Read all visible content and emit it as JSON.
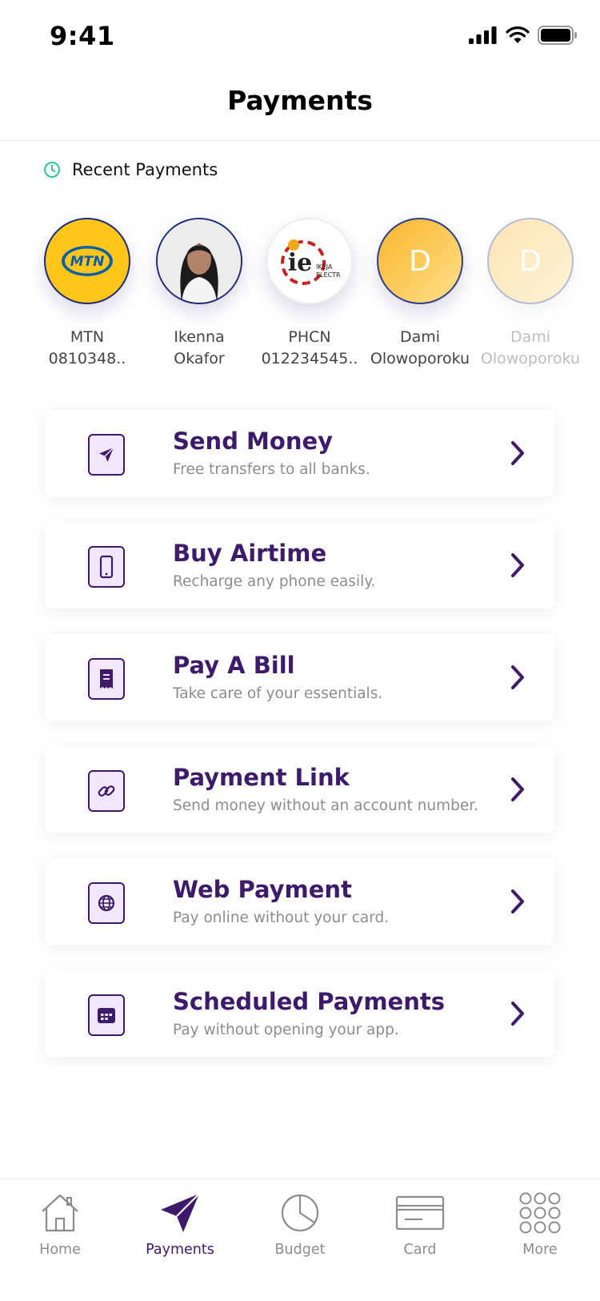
{
  "status_bar": {
    "time": "9:41"
  },
  "header": {
    "title": "Payments"
  },
  "recent": {
    "title": "Recent Payments",
    "items": [
      {
        "line1": "MTN",
        "line2": "0810348..",
        "avatar": "mtn-logo"
      },
      {
        "line1": "Ikenna",
        "line2": "Okafor",
        "avatar": "photo"
      },
      {
        "line1": "PHCN",
        "line2": "012234545..",
        "avatar": "ikeja-electric-logo",
        "logo_text": "ie",
        "logo_sub": "IKEJA ELECTRIC"
      },
      {
        "line1": "Dami",
        "line2": "Olowoporoku",
        "avatar": "letter",
        "initial": "D"
      },
      {
        "line1": "Dami",
        "line2": "Olowoporoku",
        "avatar": "letter",
        "initial": "D"
      }
    ]
  },
  "actions": [
    {
      "title": "Send Money",
      "subtitle": "Free transfers to all banks.",
      "icon": "send-icon"
    },
    {
      "title": "Buy Airtime",
      "subtitle": "Recharge any phone easily.",
      "icon": "phone-icon"
    },
    {
      "title": "Pay A Bill",
      "subtitle": "Take care of your essentials.",
      "icon": "receipt-icon"
    },
    {
      "title": "Payment Link",
      "subtitle": "Send money without an account number.",
      "icon": "link-icon"
    },
    {
      "title": "Web Payment",
      "subtitle": "Pay online without your card.",
      "icon": "globe-icon"
    },
    {
      "title": "Scheduled Payments",
      "subtitle": "Pay without opening your app.",
      "icon": "calendar-icon"
    }
  ],
  "tab_bar": {
    "active": "Payments",
    "tabs": [
      {
        "label": "Home",
        "icon": "home-icon"
      },
      {
        "label": "Payments",
        "icon": "paper-plane-icon"
      },
      {
        "label": "Budget",
        "icon": "pie-chart-icon"
      },
      {
        "label": "Card",
        "icon": "card-icon"
      },
      {
        "label": "More",
        "icon": "grid-icon"
      }
    ]
  },
  "colors": {
    "brand": "#3e1a6b",
    "clock_icon": "#2dc98f",
    "mtn_yellow": "#ffc61a",
    "avatar_gradient_start": "#f9b52c",
    "avatar_gradient_end": "#fde08a"
  }
}
